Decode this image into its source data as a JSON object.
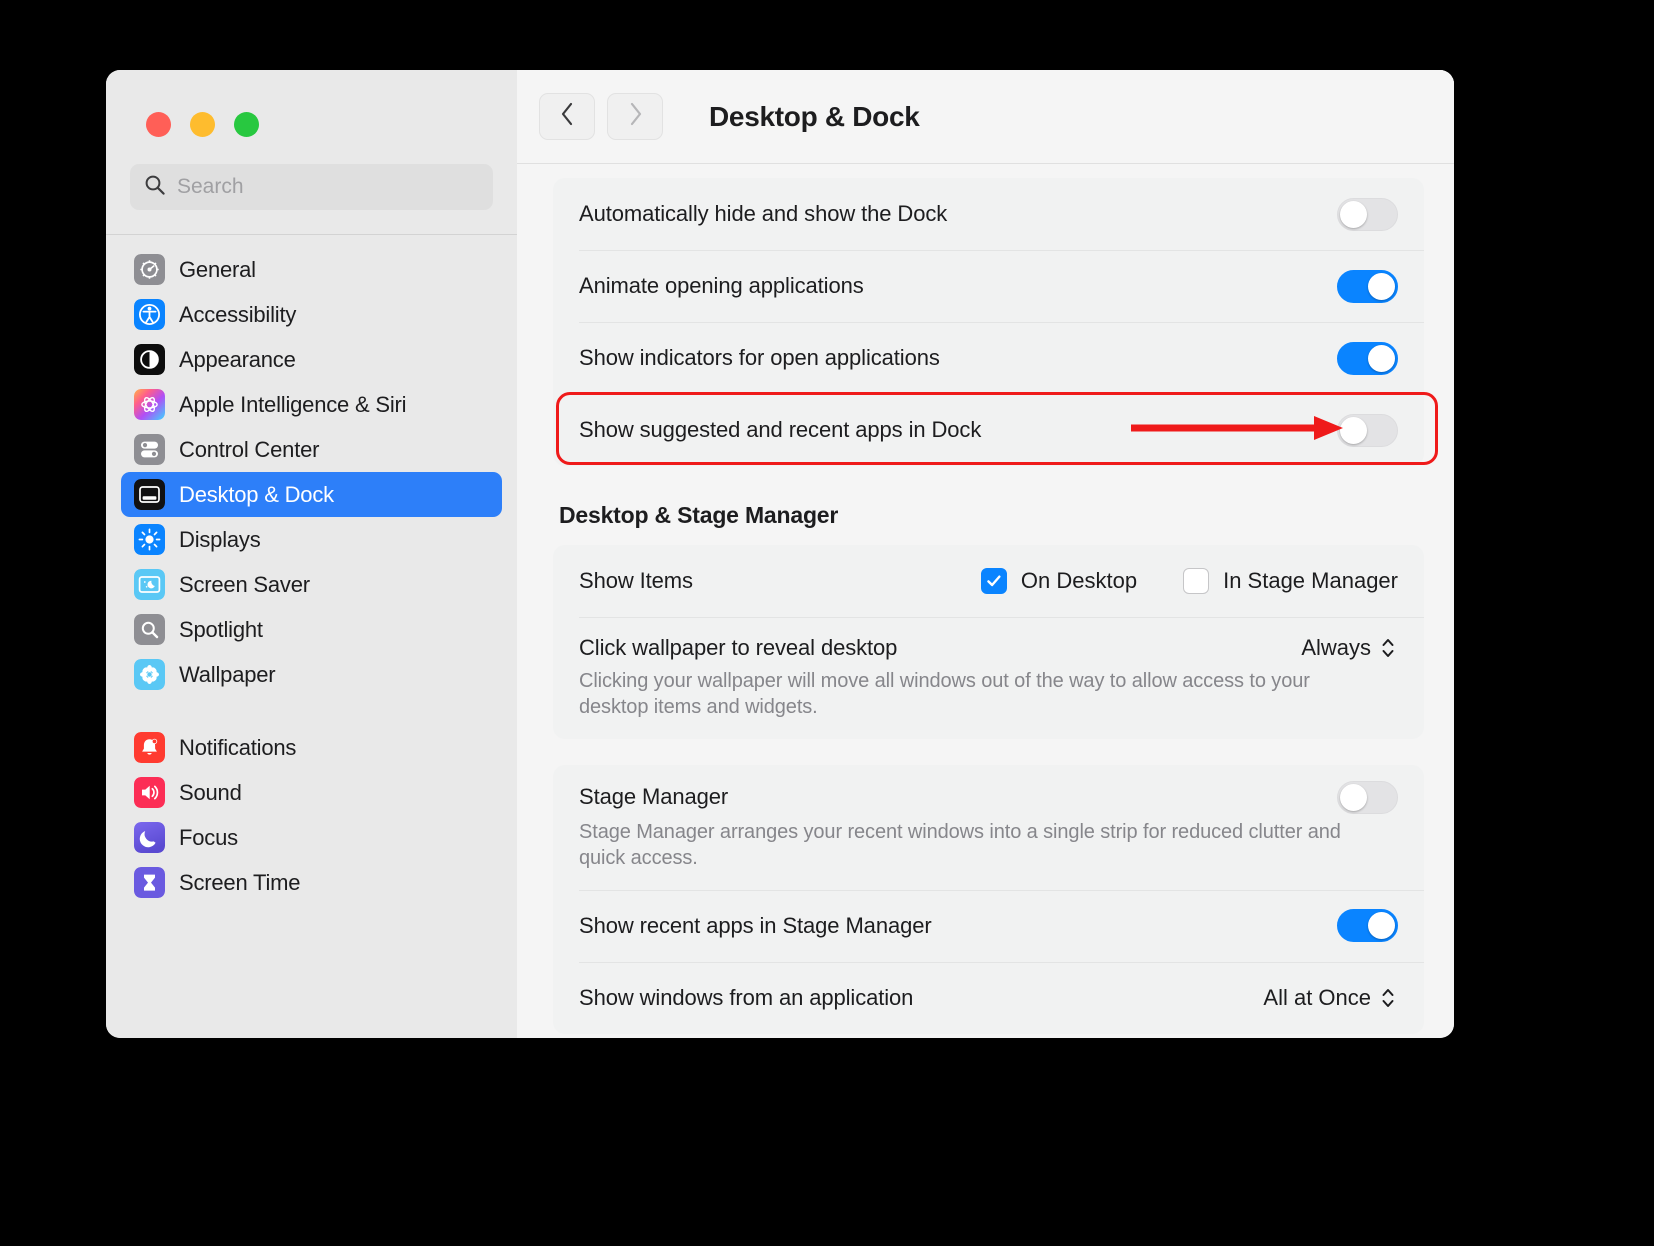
{
  "window": {
    "traffic_lights": [
      "close",
      "minimize",
      "zoom"
    ],
    "title": "Desktop & Dock"
  },
  "search": {
    "placeholder": "Search",
    "value": "",
    "icon": "search-icon"
  },
  "toolbar": {
    "back_icon": "chevron-left-icon",
    "forward_icon": "chevron-right-icon",
    "title": "Desktop & Dock"
  },
  "sidebar": {
    "groups": [
      {
        "items": [
          {
            "label": "General",
            "icon": "gear-icon",
            "selected": false
          },
          {
            "label": "Accessibility",
            "icon": "accessibility-icon",
            "selected": false
          },
          {
            "label": "Appearance",
            "icon": "appearance-icon",
            "selected": false
          },
          {
            "label": "Apple Intelligence & Siri",
            "icon": "siri-icon",
            "selected": false
          },
          {
            "label": "Control Center",
            "icon": "control-center-icon",
            "selected": false
          },
          {
            "label": "Desktop & Dock",
            "icon": "desktop-dock-icon",
            "selected": true
          },
          {
            "label": "Displays",
            "icon": "displays-icon",
            "selected": false
          },
          {
            "label": "Screen Saver",
            "icon": "screen-saver-icon",
            "selected": false
          },
          {
            "label": "Spotlight",
            "icon": "spotlight-icon",
            "selected": false
          },
          {
            "label": "Wallpaper",
            "icon": "wallpaper-icon",
            "selected": false
          }
        ]
      },
      {
        "items": [
          {
            "label": "Notifications",
            "icon": "notifications-icon",
            "selected": false
          },
          {
            "label": "Sound",
            "icon": "sound-icon",
            "selected": false
          },
          {
            "label": "Focus",
            "icon": "focus-icon",
            "selected": false
          },
          {
            "label": "Screen Time",
            "icon": "screen-time-icon",
            "selected": false
          }
        ]
      }
    ]
  },
  "dock_section": {
    "rows": [
      {
        "label": "Automatically hide and show the Dock",
        "toggle": "off"
      },
      {
        "label": "Animate opening applications",
        "toggle": "on"
      },
      {
        "label": "Show indicators for open applications",
        "toggle": "on"
      },
      {
        "label": "Show suggested and recent apps in Dock",
        "toggle": "off",
        "highlighted": true
      }
    ]
  },
  "stage_section": {
    "heading": "Desktop & Stage Manager",
    "show_items": {
      "label": "Show Items",
      "options": [
        {
          "label": "On Desktop",
          "checked": true
        },
        {
          "label": "In Stage Manager",
          "checked": false
        }
      ]
    },
    "click_wallpaper": {
      "label": "Click wallpaper to reveal desktop",
      "value": "Always",
      "description": "Clicking your wallpaper will move all windows out of the way to allow access to your desktop items and widgets."
    },
    "stage_manager": {
      "label": "Stage Manager",
      "description": "Stage Manager arranges your recent windows into a single strip for reduced clutter and quick access.",
      "toggle": "off"
    },
    "show_recent_apps": {
      "label": "Show recent apps in Stage Manager",
      "toggle": "on"
    },
    "show_windows": {
      "label": "Show windows from an application",
      "value": "All at Once"
    }
  },
  "annotation": {
    "box_color": "#ef1a1a",
    "arrow_color": "#ef1a1a",
    "target": "Show suggested and recent apps in Dock toggle"
  },
  "colors": {
    "accent": "#0a84ff",
    "selection": "#2d7ff9",
    "window_bg": "#ececec",
    "sidebar_bg": "#e9e9e9",
    "panel_bg": "#f5f5f5",
    "card_bg": "#f1f2f2",
    "annotation_red": "#ef1a1a"
  }
}
